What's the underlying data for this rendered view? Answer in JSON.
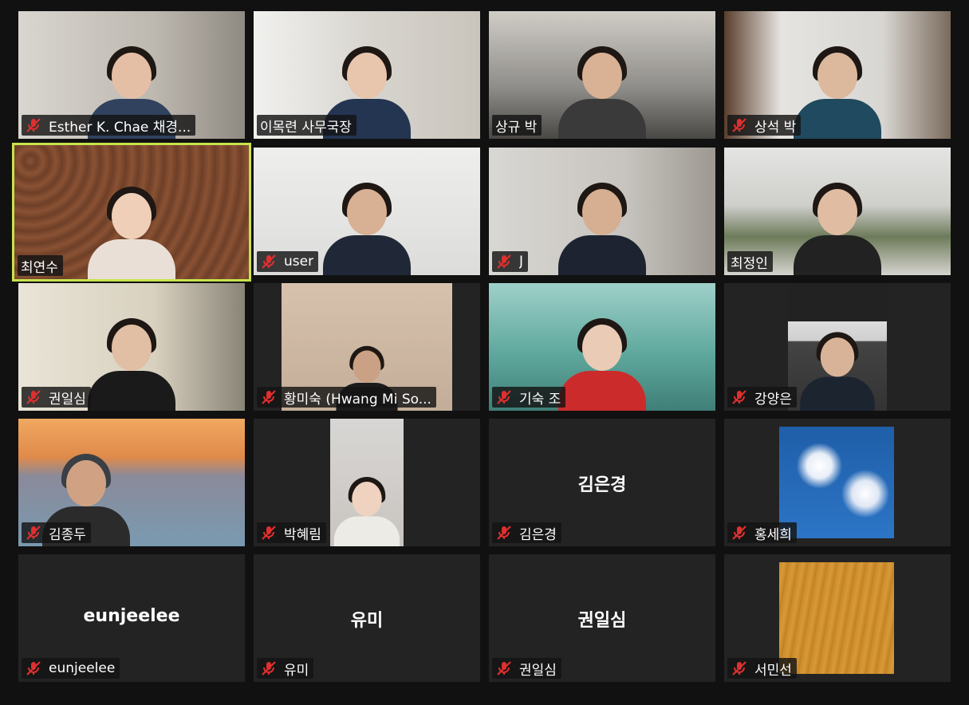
{
  "meeting": {
    "muted_icon": "microphone-muted-icon",
    "active_speaker_color": "#c7e34c",
    "participants": [
      {
        "name": "Esther K. Chae 채경...",
        "muted": true,
        "video": true
      },
      {
        "name": "이목련 사무국장",
        "muted": false,
        "video": true
      },
      {
        "name": "상규 박",
        "muted": false,
        "video": true
      },
      {
        "name": "상석 박",
        "muted": true,
        "video": true
      },
      {
        "name": "최연수",
        "muted": false,
        "video": true,
        "active": true
      },
      {
        "name": "user",
        "muted": true,
        "video": true
      },
      {
        "name": "J",
        "muted": true,
        "video": true
      },
      {
        "name": "최정인",
        "muted": false,
        "video": true
      },
      {
        "name": "권일심",
        "muted": true,
        "video": true
      },
      {
        "name": "황미숙 (Hwang Mi So...",
        "muted": true,
        "video": true
      },
      {
        "name": "기숙 조",
        "muted": true,
        "video": true
      },
      {
        "name": "강양은",
        "muted": true,
        "video": true
      },
      {
        "name": "김종두",
        "muted": true,
        "video": true
      },
      {
        "name": "박혜림",
        "muted": true,
        "video": true
      },
      {
        "name": "김은경",
        "muted": true,
        "video": false,
        "display_name": "김은경"
      },
      {
        "name": "홍세희",
        "muted": true,
        "video": true
      },
      {
        "name": "eunjeelee",
        "muted": true,
        "video": false,
        "display_name": "eunjeelee"
      },
      {
        "name": "유미",
        "muted": true,
        "video": false,
        "display_name": "유미"
      },
      {
        "name": "권일심",
        "muted": true,
        "video": false,
        "display_name": "권일심"
      },
      {
        "name": "서민선",
        "muted": true,
        "video": true
      }
    ]
  }
}
